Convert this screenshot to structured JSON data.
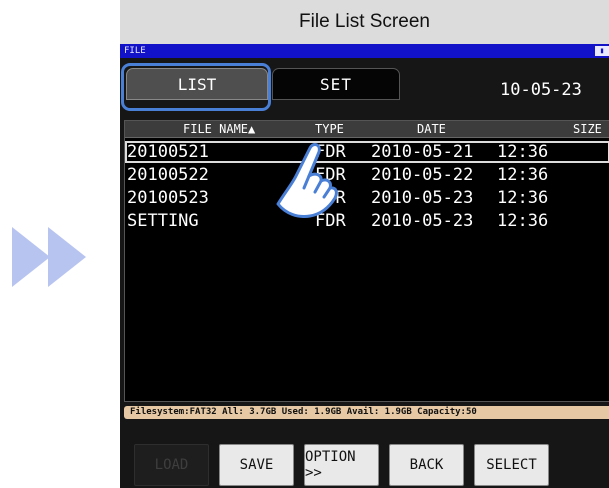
{
  "caption": "File List Screen",
  "device": {
    "title_label": "FILE",
    "title_icon": "battery-icon",
    "tabs": [
      {
        "label": "LIST",
        "active": true
      },
      {
        "label": "SET",
        "active": false
      }
    ],
    "date": "10-05-23",
    "columns": {
      "name": "FILE NAME▲",
      "type": "TYPE",
      "date": "DATE",
      "size": "SIZE"
    },
    "files": [
      {
        "name": "20100521",
        "type": "FDR",
        "date": "2010-05-21",
        "time": "12:36",
        "selected": true
      },
      {
        "name": "20100522",
        "type": "FDR",
        "date": "2010-05-22",
        "time": "12:36",
        "selected": false
      },
      {
        "name": "20100523",
        "type": "FDR",
        "date": "2010-05-23",
        "time": "12:36",
        "selected": false
      },
      {
        "name": "SETTING",
        "type": "FDR",
        "date": "2010-05-23",
        "time": "12:36",
        "selected": false
      }
    ],
    "status": "Filesystem:FAT32 All: 3.7GB Used: 1.9GB Avail: 1.9GB Capacity:50",
    "buttons": [
      {
        "label": "LOAD",
        "enabled": false
      },
      {
        "label": "SAVE",
        "enabled": true
      },
      {
        "label": "OPTION >>",
        "enabled": true
      },
      {
        "label": "BACK",
        "enabled": true
      },
      {
        "label": "SELECT",
        "enabled": true
      }
    ]
  },
  "icons": {
    "next": "double-chevron-right-icon",
    "pointer": "pointing-hand-icon"
  },
  "colors": {
    "title_bar": "#1212c8",
    "highlight": "#4a7fd6",
    "arrow": "#b8c4f0",
    "status_bar": "#e6c9a4"
  }
}
